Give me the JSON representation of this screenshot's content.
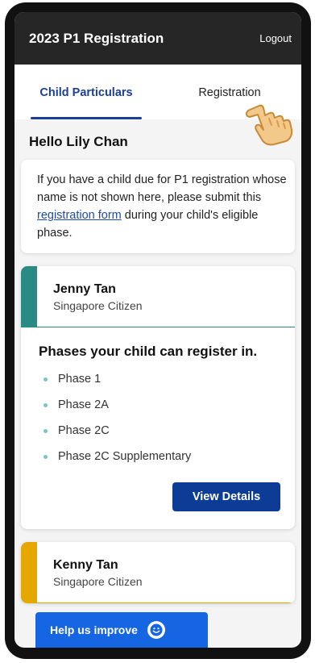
{
  "header": {
    "title": "2023 P1 Registration",
    "logout_label": "Logout"
  },
  "tabs": [
    {
      "label": "Child Particulars",
      "active": true
    },
    {
      "label": "Registration",
      "active": false
    }
  ],
  "greeting": "Hello Lily Chan",
  "info": {
    "text_before": "If you have a child due for P1 registration whose name is not shown here, please submit this ",
    "link_text": "registration form",
    "text_after": " during your child's eligible phase."
  },
  "children": [
    {
      "name": "Jenny Tan",
      "status": "Singapore Citizen",
      "accent_color": "#2a8b84",
      "phases_title": "Phases your child can register in.",
      "phases": [
        "Phase 1",
        "Phase 2A",
        "Phase 2C",
        "Phase 2C Supplementary"
      ],
      "button_label": "View Details"
    },
    {
      "name": "Kenny Tan",
      "status": "Singapore Citizen",
      "accent_color": "#e4a800"
    }
  ],
  "feedback": {
    "label": "Help us improve",
    "icon": "smiley-icon"
  },
  "colors": {
    "primary": "#0c3c96",
    "header": "#262626",
    "help": "#1666e3"
  }
}
